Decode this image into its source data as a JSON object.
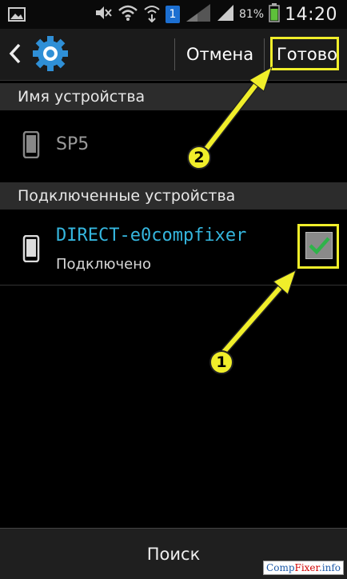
{
  "status_bar": {
    "time": "14:20",
    "battery_percent": "81%",
    "notification_badge": "1",
    "icons": [
      "gallery-icon",
      "mute-icon",
      "wifi-icon",
      "wifi-direct-icon",
      "signal-icon",
      "battery-icon"
    ]
  },
  "action_bar": {
    "cancel_label": "Отмена",
    "done_label": "Готово"
  },
  "sections": {
    "device_name_header": "Имя устройства",
    "connected_header": "Подключенные устройства"
  },
  "device_name": {
    "value": "SP5"
  },
  "connected_devices": [
    {
      "name": "DIRECT-e0compfixer",
      "status": "Подключено",
      "checked": true
    }
  ],
  "annotations": {
    "marker_1": "1",
    "marker_2": "2"
  },
  "bottom_bar": {
    "search_label": "Поиск"
  },
  "watermark": {
    "part1": "Comp",
    "part2": "Fixer",
    "part3": ".info"
  },
  "colors": {
    "accent": "#35b6de",
    "highlight": "#f0ee2a",
    "check": "#2fb34a"
  }
}
